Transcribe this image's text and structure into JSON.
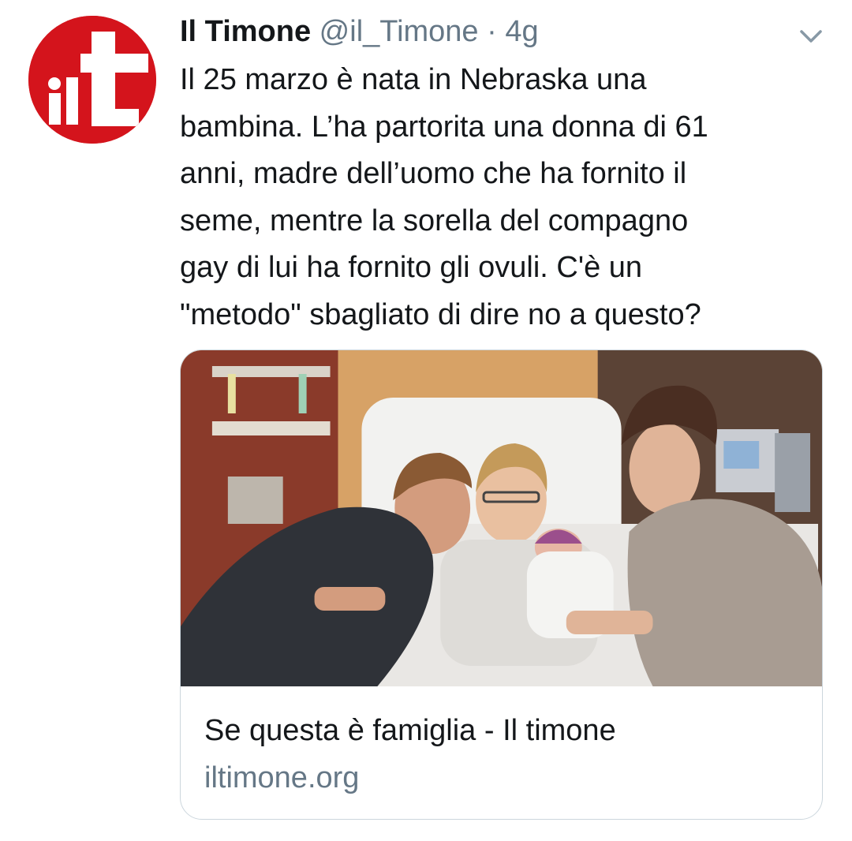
{
  "tweet": {
    "author_name": "Il Timone",
    "author_handle": "@il_Timone",
    "separator": "·",
    "time": "4g",
    "avatar_icon": "il-timone-logo",
    "menu_icon": "chevron-down-icon",
    "text": "Il 25 marzo è nata in Nebraska una\nbambina. L’ha partorita una donna di 61\nanni, madre dell’uomo che ha fornito il\nseme, mentre la sorella del compagno\ngay di lui ha fornito gli ovuli. C'è un\n\"metodo\" sbagliato di dire no a questo?"
  },
  "card": {
    "title": "Se questa è famiglia - Il timone",
    "domain": "iltimone.org"
  },
  "colors": {
    "brand_red": "#d4141c",
    "secondary_text": "#657786",
    "primary_text": "#14171a",
    "border": "#ccd6dd"
  }
}
